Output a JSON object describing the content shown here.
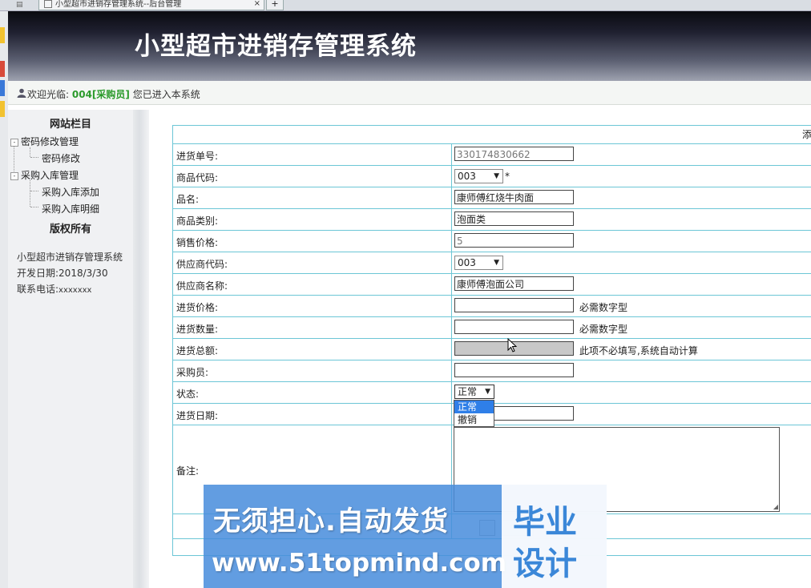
{
  "browser": {
    "tab_title": "小型超市进销存管理系统--后台管理",
    "tab_close": "×",
    "new_tab": "+"
  },
  "header": {
    "title": "小型超市进销存管理系统"
  },
  "welcome": {
    "prefix": "欢迎光临:",
    "user": "004[采购员]",
    "suffix": "您已进入本系统"
  },
  "sidebar": {
    "heading": "网站栏目",
    "groups": [
      {
        "label": "密码修改管理",
        "toggle": "-",
        "items": [
          "密码修改"
        ]
      },
      {
        "label": "采购入库管理",
        "toggle": "-",
        "items": [
          "采购入库添加",
          "采购入库明细"
        ]
      }
    ],
    "rights": "版权所有",
    "info": {
      "system": "小型超市进销存管理系统",
      "dev_date_label": "开发日期:",
      "dev_date": "2018/3/30",
      "phone_label": "联系电话:",
      "phone": "xxxxxxx"
    }
  },
  "form": {
    "title_fragment": "添",
    "fields": {
      "order_no": {
        "label": "进货单号:",
        "value": "330174830662"
      },
      "product_code": {
        "label": "商品代码:",
        "value": "003",
        "required_mark": "*"
      },
      "product_name": {
        "label": "品名:",
        "value": "康师傅红烧牛肉面"
      },
      "category": {
        "label": "商品类别:",
        "value": "泡面类"
      },
      "sale_price": {
        "label": "销售价格:",
        "value": "5"
      },
      "supplier_code": {
        "label": "供应商代码:",
        "value": "003"
      },
      "supplier_name": {
        "label": "供应商名称:",
        "value": "康师傅泡面公司"
      },
      "purchase_price": {
        "label": "进货价格:",
        "value": "",
        "hint": "必需数字型"
      },
      "quantity": {
        "label": "进货数量:",
        "value": "",
        "hint": "必需数字型"
      },
      "total": {
        "label": "进货总额:",
        "value": "",
        "hint": "此项不必填写,系统自动计算"
      },
      "buyer": {
        "label": "采购员:",
        "value": ""
      },
      "status": {
        "label": "状态:",
        "value": "正常",
        "options": [
          "正常",
          "撤销"
        ]
      },
      "date": {
        "label": "进货日期:",
        "value": ""
      },
      "remark": {
        "label": "备注:",
        "value": ""
      }
    }
  },
  "watermark": {
    "line1": "无须担心.自动发货",
    "line2": "www.51topmind.com",
    "box1": "毕业",
    "box2": "设计"
  },
  "colors": {
    "table_border": "#6cc6d6",
    "welcome_user": "#2a9a2a",
    "dropdown_highlight": "#2f7fe8",
    "watermark": "#468cdc"
  }
}
